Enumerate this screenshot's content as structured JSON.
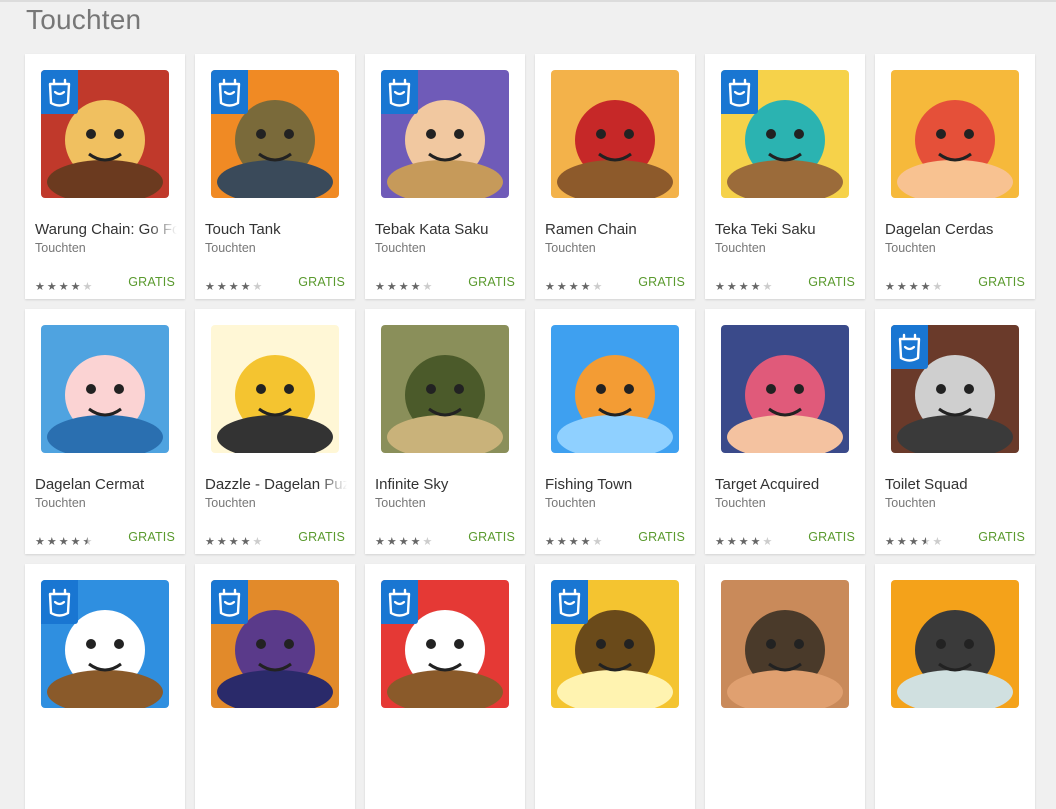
{
  "section_title": "Touchten",
  "apps": [
    {
      "title": "Warung Chain: Go Food",
      "developer": "Touchten",
      "price": "GRATIS",
      "rating": 4.0,
      "family_badge": true,
      "icon": "warung-chain-icon",
      "colors": [
        "#c0392b",
        "#f0c060",
        "#6b3a1f"
      ]
    },
    {
      "title": "Touch Tank",
      "developer": "Touchten",
      "price": "GRATIS",
      "rating": 4.0,
      "family_badge": true,
      "icon": "touch-tank-icon",
      "colors": [
        "#f08a24",
        "#7a6a3a",
        "#3a4a5a"
      ]
    },
    {
      "title": "Tebak Kata Saku",
      "developer": "Touchten",
      "price": "GRATIS",
      "rating": 4.0,
      "family_badge": true,
      "icon": "tebak-kata-icon",
      "colors": [
        "#6f5bb8",
        "#f1c8a0",
        "#c69a5a"
      ]
    },
    {
      "title": "Ramen Chain",
      "developer": "Touchten",
      "price": "GRATIS",
      "rating": 4.0,
      "family_badge": false,
      "icon": "ramen-chain-icon",
      "colors": [
        "#f3b24a",
        "#c62828",
        "#8d5a2b"
      ]
    },
    {
      "title": "Teka Teki Saku",
      "developer": "Touchten",
      "price": "GRATIS",
      "rating": 4.0,
      "family_badge": true,
      "icon": "teka-teki-icon",
      "colors": [
        "#f6d24a",
        "#2bb3b1",
        "#9b6b3a"
      ]
    },
    {
      "title": "Dagelan Cerdas",
      "developer": "Touchten",
      "price": "GRATIS",
      "rating": 4.0,
      "family_badge": false,
      "icon": "dagelan-cerdas-icon",
      "colors": [
        "#f6b93b",
        "#e55039",
        "#f8c291"
      ]
    },
    {
      "title": "Dagelan Cermat",
      "developer": "Touchten",
      "price": "GRATIS",
      "rating": 4.5,
      "family_badge": false,
      "icon": "dagelan-cermat-icon",
      "colors": [
        "#4fa3e0",
        "#fbd3d3",
        "#2a6fb0"
      ]
    },
    {
      "title": "Dazzle - Dagelan Puzzle",
      "developer": "Touchten",
      "price": "GRATIS",
      "rating": 4.0,
      "family_badge": false,
      "icon": "dazzle-icon",
      "colors": [
        "#fff7d6",
        "#f4c430",
        "#333333"
      ]
    },
    {
      "title": "Infinite Sky",
      "developer": "Touchten",
      "price": "GRATIS",
      "rating": 4.0,
      "family_badge": false,
      "icon": "infinite-sky-icon",
      "colors": [
        "#8a8f5a",
        "#4b5a2a",
        "#c9b27a"
      ]
    },
    {
      "title": "Fishing Town",
      "developer": "Touchten",
      "price": "GRATIS",
      "rating": 4.0,
      "family_badge": false,
      "icon": "fishing-town-icon",
      "colors": [
        "#3ea0f0",
        "#f39c34",
        "#8fd0ff"
      ]
    },
    {
      "title": "Target Acquired",
      "developer": "Touchten",
      "price": "GRATIS",
      "rating": 4.0,
      "family_badge": false,
      "icon": "target-acquired-icon",
      "colors": [
        "#3a4a8a",
        "#e05a7a",
        "#f4c2a0"
      ]
    },
    {
      "title": "Toilet Squad",
      "developer": "Touchten",
      "price": "GRATIS",
      "rating": 3.5,
      "family_badge": true,
      "icon": "toilet-squad-icon",
      "colors": [
        "#6a3a2a",
        "#cfcfcf",
        "#3a3a3a"
      ]
    },
    {
      "title": "",
      "developer": "",
      "price": "",
      "rating": 0,
      "family_badge": true,
      "icon": "app-icon-13",
      "colors": [
        "#2f8fe0",
        "#ffffff",
        "#8a5a2a"
      ]
    },
    {
      "title": "",
      "developer": "",
      "price": "",
      "rating": 0,
      "family_badge": true,
      "icon": "app-icon-14",
      "colors": [
        "#e28a2a",
        "#5a3a8a",
        "#2a2a6a"
      ]
    },
    {
      "title": "",
      "developer": "",
      "price": "",
      "rating": 0,
      "family_badge": true,
      "icon": "app-icon-15",
      "colors": [
        "#e53935",
        "#ffffff",
        "#8a5a2a"
      ]
    },
    {
      "title": "",
      "developer": "",
      "price": "",
      "rating": 0,
      "family_badge": true,
      "icon": "app-icon-16",
      "colors": [
        "#f4c430",
        "#6a4a1a",
        "#fff3b0"
      ]
    },
    {
      "title": "",
      "developer": "",
      "price": "",
      "rating": 0,
      "family_badge": false,
      "icon": "app-icon-17",
      "colors": [
        "#c98a5a",
        "#4a3a2a",
        "#e0a070"
      ]
    },
    {
      "title": "",
      "developer": "",
      "price": "",
      "rating": 0,
      "family_badge": false,
      "icon": "app-icon-18",
      "colors": [
        "#f4a21a",
        "#3a3a3a",
        "#d0e0e0"
      ]
    }
  ]
}
